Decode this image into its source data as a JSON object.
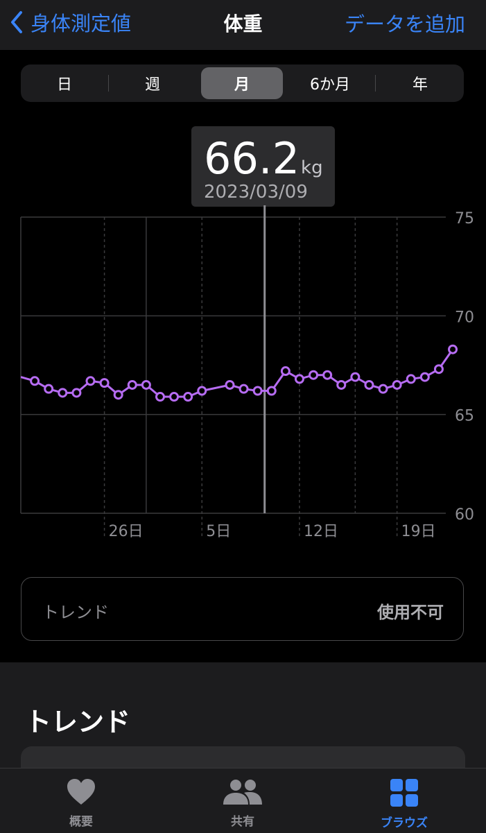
{
  "nav": {
    "back_label": "身体測定値",
    "title": "体重",
    "add_label": "データを追加"
  },
  "segments": [
    "日",
    "週",
    "月",
    "6か月",
    "年"
  ],
  "selected_segment": "月",
  "tooltip": {
    "value": "66.2",
    "unit": "kg",
    "date": "2023/03/09"
  },
  "chart_data": {
    "type": "line",
    "y_axis_side": "right",
    "ylim": [
      60,
      75
    ],
    "y_ticks": [
      "75",
      "70",
      "65",
      "60"
    ],
    "x_ticks": [
      {
        "label": "26日",
        "x": 5
      },
      {
        "label": "5日",
        "x": 12
      },
      {
        "label": "12日",
        "x": 19
      },
      {
        "label": "19日",
        "x": 26
      }
    ],
    "xlim": [
      -1,
      29.5
    ],
    "selected_x": 16.5,
    "series": [
      {
        "color": "#b66cf2",
        "x": [
          0,
          1,
          2,
          3,
          4,
          5,
          6,
          7,
          8,
          9,
          10,
          11,
          12,
          14,
          15,
          16,
          17,
          18,
          19,
          20,
          21,
          22,
          23,
          24,
          25,
          26,
          27,
          28,
          29,
          30
        ],
        "y": [
          66.7,
          66.3,
          66.1,
          66.1,
          66.7,
          66.6,
          66.0,
          66.5,
          66.5,
          65.9,
          65.9,
          65.9,
          66.2,
          66.5,
          66.3,
          66.2,
          66.2,
          67.2,
          66.8,
          67.0,
          67.0,
          66.5,
          66.9,
          66.5,
          66.3,
          66.5,
          66.8,
          66.9,
          67.3,
          68.3
        ]
      }
    ]
  },
  "trend_row": {
    "label": "トレンド",
    "status": "使用不可"
  },
  "section_title": "トレンド",
  "tabbar": [
    {
      "label": "概要",
      "icon": "heart-icon"
    },
    {
      "label": "共有",
      "icon": "people-icon"
    },
    {
      "label": "ブラウズ",
      "icon": "grid-icon"
    }
  ],
  "colors": {
    "accent": "#3a84f7",
    "series": "#b66cf2"
  }
}
